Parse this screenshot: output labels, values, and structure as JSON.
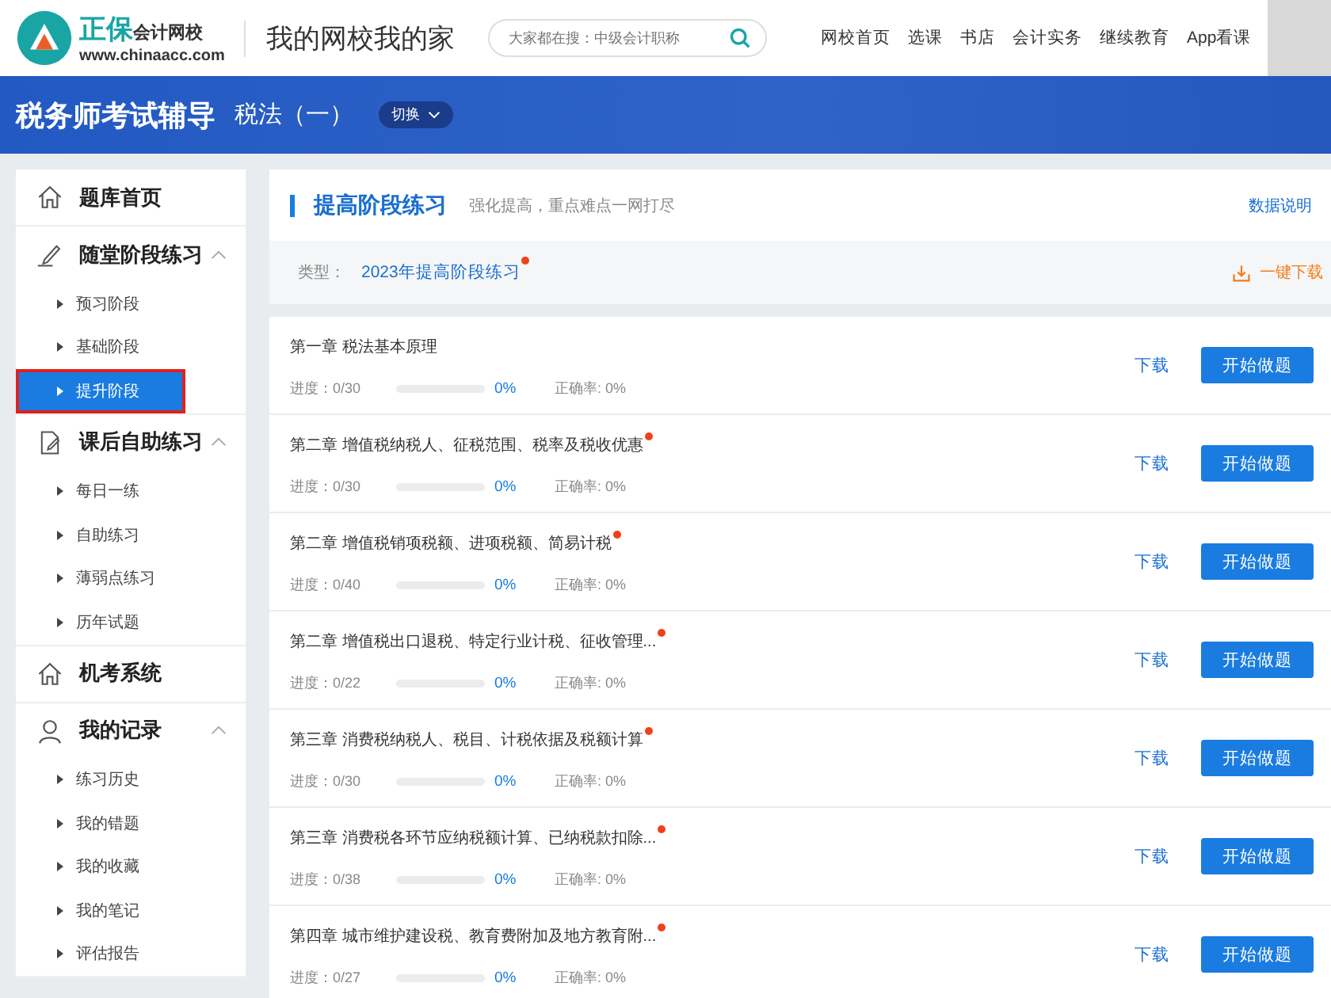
{
  "header": {
    "logo_brand": "正保",
    "logo_name": "会计网校",
    "logo_url": "www.chinaacc.com",
    "slogan": "我的网校我的家",
    "search": {
      "placeholder": "大家都在搜：中级会计职称"
    },
    "nav": [
      "网校首页",
      "选课",
      "书店",
      "会计实务",
      "继续教育",
      "App看课"
    ]
  },
  "banner": {
    "title": "税务师考试辅导",
    "subject": "税法（一）",
    "switch_button": "切换"
  },
  "sidebar": {
    "items": [
      {
        "label": "题库首页"
      },
      {
        "label": "随堂阶段练习",
        "expanded": true,
        "children": [
          {
            "label": "预习阶段",
            "selected": false
          },
          {
            "label": "基础阶段",
            "selected": false
          },
          {
            "label": "提升阶段",
            "selected": true
          }
        ]
      },
      {
        "label": "课后自助练习",
        "expanded": true,
        "children": [
          {
            "label": "每日一练",
            "selected": false
          },
          {
            "label": "自助练习",
            "selected": false
          },
          {
            "label": "薄弱点练习",
            "selected": false
          },
          {
            "label": "历年试题",
            "selected": false
          }
        ]
      },
      {
        "label": "机考系统"
      },
      {
        "label": "我的记录",
        "expanded": true,
        "children": [
          {
            "label": "练习历史",
            "selected": false
          },
          {
            "label": "我的错题",
            "selected": false
          },
          {
            "label": "我的收藏",
            "selected": false
          },
          {
            "label": "我的笔记",
            "selected": false
          },
          {
            "label": "评估报告",
            "selected": false
          }
        ]
      }
    ]
  },
  "section": {
    "title": "提高阶段练习",
    "subtitle": "强化提高，重点难点一网打尽",
    "data_link": "数据说明",
    "type_label": "类型：",
    "type_value": "2023年提高阶段练习",
    "type_new": true,
    "download_all": "一键下载"
  },
  "chapters": [
    {
      "title": "第一章 税法基本原理",
      "new": false,
      "progress": "进度：0/30",
      "level": 0,
      "percent": "0%",
      "accuracy": "正确率: 0%",
      "download": "下载",
      "start": "开始做题"
    },
    {
      "title": "第二章 增值税纳税人、征税范围、税率及税收优惠",
      "new": true,
      "progress": "进度：0/30",
      "level": 0,
      "percent": "0%",
      "accuracy": "正确率: 0%",
      "download": "下载",
      "start": "开始做题"
    },
    {
      "title": "第二章 增值税销项税额、进项税额、简易计税",
      "new": true,
      "progress": "进度：0/40",
      "level": 0,
      "percent": "0%",
      "accuracy": "正确率: 0%",
      "download": "下载",
      "start": "开始做题"
    },
    {
      "title": "第二章 增值税出口退税、特定行业计税、征收管理...",
      "new": true,
      "progress": "进度：0/22",
      "level": 0,
      "percent": "0%",
      "accuracy": "正确率: 0%",
      "download": "下载",
      "start": "开始做题"
    },
    {
      "title": "第三章 消费税纳税人、税目、计税依据及税额计算",
      "new": true,
      "progress": "进度：0/30",
      "level": 0,
      "percent": "0%",
      "accuracy": "正确率: 0%",
      "download": "下载",
      "start": "开始做题"
    },
    {
      "title": "第三章 消费税各环节应纳税额计算、已纳税款扣除...",
      "new": true,
      "progress": "进度：0/38",
      "level": 0,
      "percent": "0%",
      "accuracy": "正确率: 0%",
      "download": "下载",
      "start": "开始做题"
    },
    {
      "title": "第四章 城市维护建设税、教育费附加及地方教育附...",
      "new": true,
      "progress": "进度：0/27",
      "level": 0,
      "percent": "0%",
      "accuracy": "正确率: 0%",
      "download": "下载",
      "start": "开始做题"
    }
  ]
}
